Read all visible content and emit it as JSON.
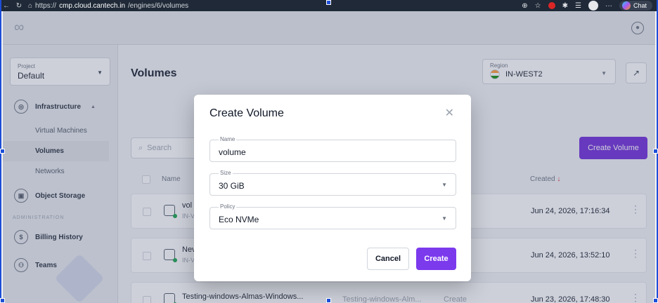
{
  "browser": {
    "url_prefix": "https://",
    "url_host": "cmp.cloud.cantech.in",
    "url_path": "/engines/6/volumes",
    "chat_label": "Chat"
  },
  "sidebar": {
    "project_label": "Project",
    "project_value": "Default",
    "groups": [
      {
        "label": "Infrastructure"
      },
      {
        "label": "Object Storage"
      },
      {
        "label": "Billing History"
      },
      {
        "label": "Teams"
      }
    ],
    "sub_items": [
      {
        "label": "Virtual Machines"
      },
      {
        "label": "Volumes"
      },
      {
        "label": "Networks"
      }
    ],
    "section_admin": "ADMINISTRATION"
  },
  "main": {
    "title": "Volumes",
    "region_label": "Region",
    "region_value": "IN-WEST2",
    "search_placeholder": "Search",
    "create_volume_label": "Create Volume",
    "columns": {
      "name": "Name",
      "created": "Created"
    },
    "rows": [
      {
        "name": "vol",
        "sub": "IN-V",
        "created": "Jun 24, 2026, 17:16:34"
      },
      {
        "name": "Nev",
        "sub": "IN-V",
        "created": "Jun 24, 2026, 13:52:10"
      },
      {
        "name": "Testing-windows-Almas-Windows...",
        "col3": "Testing-windows-Alm...",
        "col4": "Create",
        "created": "Jun 23, 2026, 17:48:30"
      }
    ]
  },
  "modal": {
    "title": "Create Volume",
    "name_label": "Name",
    "name_value": "volume",
    "size_label": "Size",
    "size_value": "30 GiB",
    "policy_label": "Policy",
    "policy_value": "Eco NVMe",
    "cancel_label": "Cancel",
    "create_label": "Create"
  },
  "colors": {
    "accent": "#7c3aed",
    "status_ok": "#16a34a"
  }
}
